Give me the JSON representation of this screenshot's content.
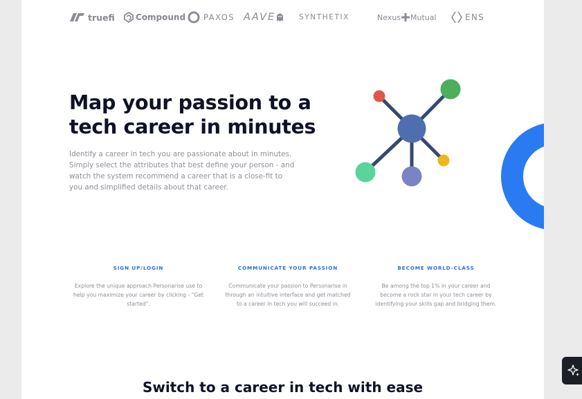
{
  "logos": [
    {
      "name": "truefi",
      "text": "truefi"
    },
    {
      "name": "compound",
      "text": "Compound"
    },
    {
      "name": "paxos",
      "text": "PAXOS"
    },
    {
      "name": "aave",
      "text": "AAVE"
    },
    {
      "name": "synthetix",
      "text": "SYNTHETIX"
    },
    {
      "name": "nexus-mutual",
      "text_left": "Nexus",
      "text_right": "Mutual"
    },
    {
      "name": "ens",
      "text": "ENS"
    }
  ],
  "hero": {
    "title_line1": "Map your passion to a",
    "title_line2": "tech career in minutes",
    "description": "Identify a career in tech you are passionate about in minutes. Simply select the attributes that best define your person - and watch the system recommend a career that is a close-fit to you and simplified details about that career."
  },
  "illustration": {
    "icon": "molecule-network-icon",
    "colors": {
      "center": "#4e6eb0",
      "red": "#de5845",
      "green": "#4caf59",
      "teal": "#5ad39c",
      "purple": "#7a83c4",
      "yellow": "#e9b81c",
      "line": "#364a6e"
    }
  },
  "ring_color": "#2a7bf2",
  "steps": [
    {
      "title": "SIGN UP/LOGIN",
      "desc_lines": [
        "Explore the unique approach Personarise use to",
        "help you maximize your career by clicking - \"Get",
        "started\"."
      ]
    },
    {
      "title": "COMMUNICATE YOUR PASSION",
      "desc_lines": [
        "Communicate your passion to Personarise in",
        "through an intuitive interface and get matched",
        "to a career in tech you will succeed in."
      ]
    },
    {
      "title": "BECOME WORLD-CLASS",
      "desc_lines": [
        "Be among the top 1% in your career and",
        "become a rock star in your tech career by",
        "identifying your skills gap and bridging them."
      ]
    }
  ],
  "section_title": "Switch to a career in tech with ease",
  "widget": {
    "icon": "sparkle-icon"
  }
}
